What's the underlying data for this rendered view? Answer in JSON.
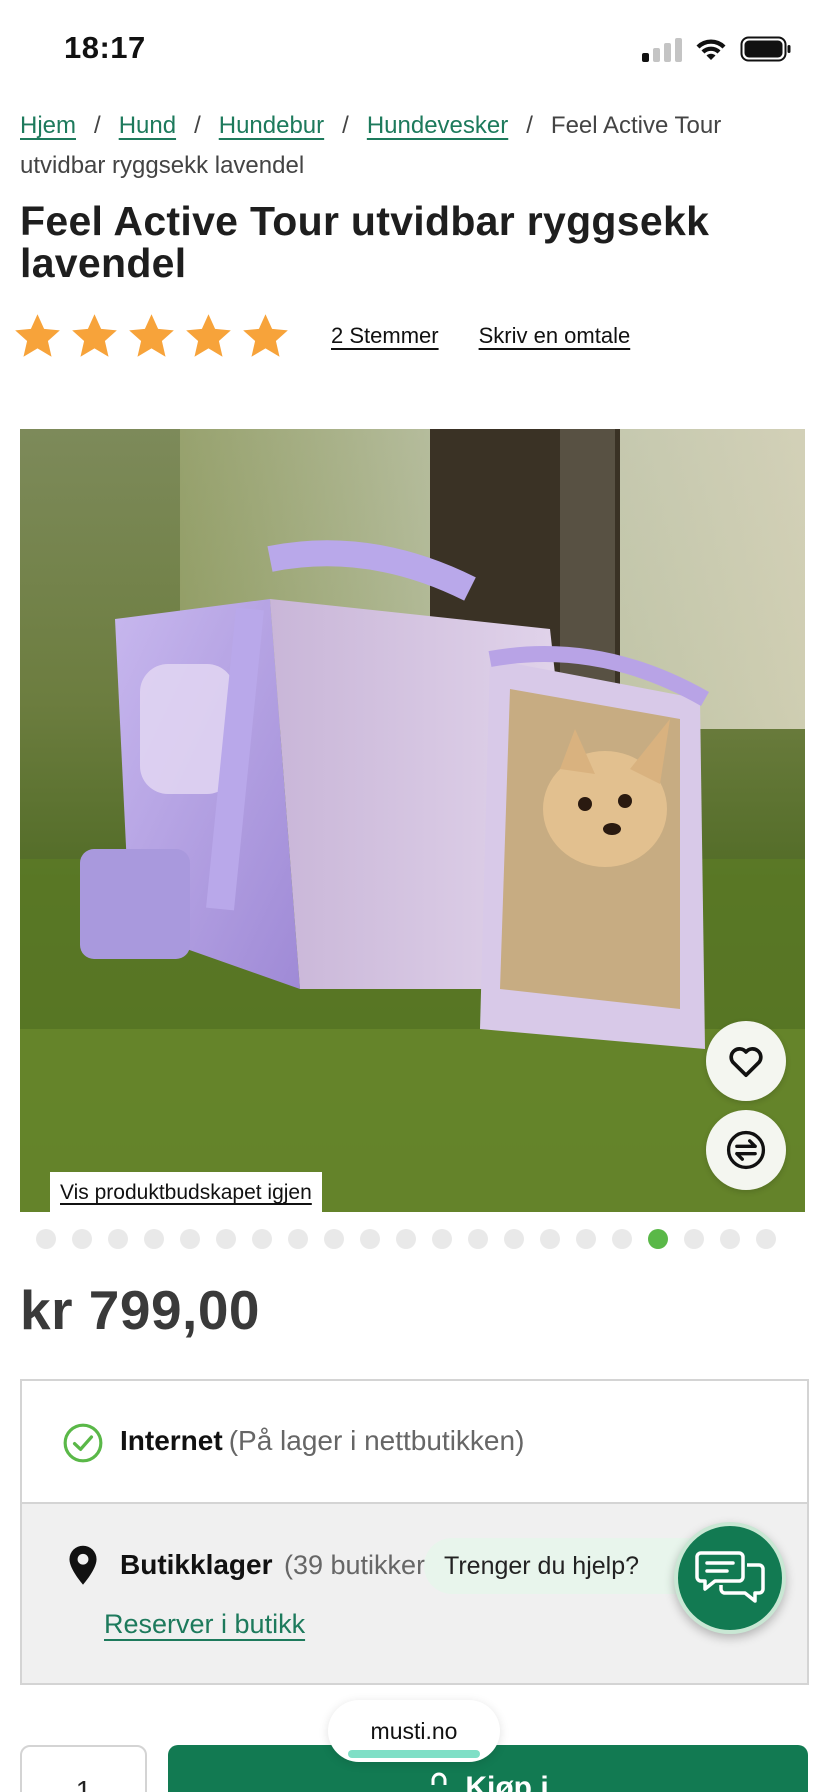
{
  "status_bar": {
    "time": "18:17"
  },
  "breadcrumb": {
    "items": [
      "Hjem",
      "Hund",
      "Hundebur",
      "Hundevesker"
    ],
    "current": "Feel Active Tour utvidbar ryggsekk lavendel",
    "separator": "/"
  },
  "product": {
    "title": "Feel Active Tour utvidbar ryggsekk lavendel",
    "rating": {
      "stars": 5,
      "max": 5,
      "votes_label": "2 Stemmer",
      "write_review_label": "Skriv en omtale"
    },
    "image": {
      "show_message_label": "Vis produktbudskapet igjen",
      "slide_count": 21,
      "active_slide": 18
    },
    "price": "kr 799,00"
  },
  "availability": {
    "online_label": "Internet",
    "online_note": "(På lager i nettbutikken)",
    "store_label": "Butikklager",
    "store_note": "(39 butikker",
    "reserve_label": "Reserver i butikk"
  },
  "help": {
    "label": "Trenger du hjelp?"
  },
  "purchase": {
    "quantity": "1",
    "buy_label": "Kjøp i"
  },
  "browser": {
    "url": "musti.no"
  },
  "colors": {
    "brand_green": "#127a52",
    "link_green": "#1d7a5c",
    "star_orange": "#f7a33a",
    "active_dot": "#5ab848"
  }
}
